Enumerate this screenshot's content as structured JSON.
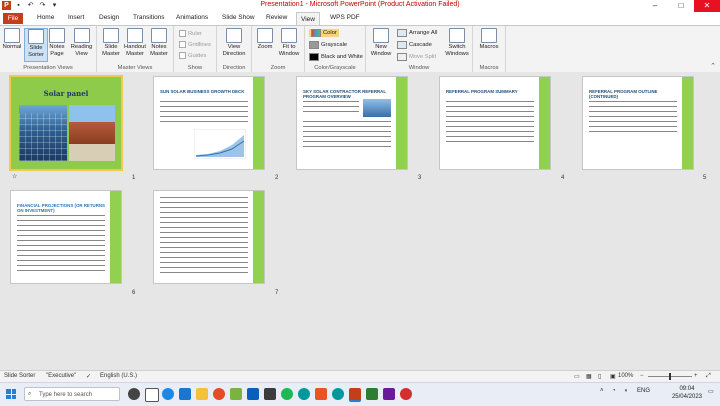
{
  "window": {
    "title": "Presentation1 - Microsoft PowerPoint (Product Activation Failed)",
    "min": "–",
    "max": "□",
    "close": "✕"
  },
  "tabs": [
    "File",
    "Home",
    "Insert",
    "Design",
    "Transitions",
    "Animations",
    "Slide Show",
    "Review",
    "View",
    "WPS PDF"
  ],
  "active_tab": "View",
  "ribbon": {
    "normal": "Normal",
    "slide_sorter": "Slide Sorter",
    "notes_page": "Notes Page",
    "reading_view": "Reading View",
    "presentation_views": "Presentation Views",
    "slide_master": "Slide Master",
    "handout_master": "Handout Master",
    "notes_master": "Notes Master",
    "master_views": "Master Views",
    "ruler": "Ruler",
    "gridlines": "Gridlines",
    "guides": "Guides",
    "show": "Show",
    "view_direction": "View Direction",
    "direction": "Direction",
    "zoom": "Zoom",
    "fit_to_window": "Fit to Window",
    "zoom_group": "Zoom",
    "color": "Color",
    "grayscale": "Grayscale",
    "black_and_white": "Black and White",
    "color_grayscale": "Color/Grayscale",
    "new_window": "New Window",
    "arrange_all": "Arrange All",
    "cascade": "Cascade",
    "move_split": "Move Split",
    "switch_windows": "Switch Windows",
    "window": "Window",
    "macros": "Macros",
    "macros_group": "Macros"
  },
  "slides": [
    {
      "num": "1",
      "title": "Solar panel"
    },
    {
      "num": "2",
      "title": "SUN SOLAR BUSINESS GROWTH DECK"
    },
    {
      "num": "3",
      "title": "SKY SOLAR CONTRACTOR REFERRAL PROGRAM OVERVIEW"
    },
    {
      "num": "4",
      "title": "REFERRAL PROGRAM SUMMARY"
    },
    {
      "num": "5",
      "title": "REFERRAL PROGRAM OUTLINE (CONTINUED)"
    },
    {
      "num": "6",
      "title": "FINANCIAL PROJECTIONS (OR RETURNS ON INVESTMENT)"
    },
    {
      "num": "7",
      "title": ""
    }
  ],
  "status": {
    "view": "Slide Sorter",
    "theme": "\"Executive\"",
    "language": "English (U.S.)",
    "zoom": "100%"
  },
  "taskbar": {
    "search_placeholder": "Type here to search",
    "lang": "ENG",
    "time": "09:04",
    "date": "25/04/2023"
  }
}
